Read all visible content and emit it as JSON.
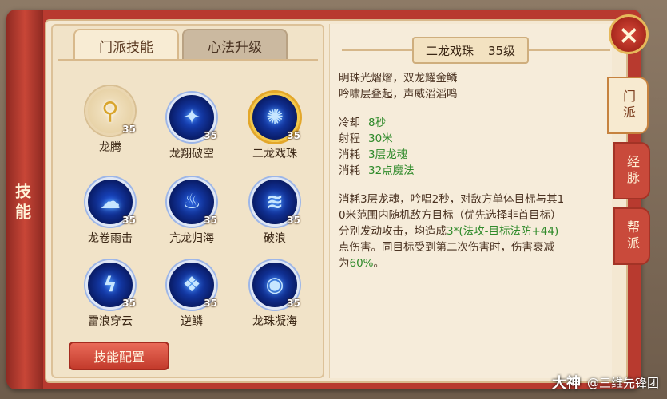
{
  "side_rail": {
    "label": "技能"
  },
  "tabs": [
    {
      "label": "门派技能",
      "active": true
    },
    {
      "label": "心法升级",
      "active": false
    }
  ],
  "skills": [
    {
      "name": "龙腾",
      "level": "35",
      "icon": "golden-mace-icon",
      "selected": false
    },
    {
      "name": "龙翔破空",
      "level": "35",
      "icon": "blue-dragon-icon",
      "selected": false
    },
    {
      "name": "二龙戏珠",
      "level": "35",
      "icon": "dragon-pearl-icon",
      "selected": true
    },
    {
      "name": "龙卷雨击",
      "level": "35",
      "icon": "storm-icon",
      "selected": false
    },
    {
      "name": "亢龙归海",
      "level": "35",
      "icon": "blue-flame-icon",
      "selected": false
    },
    {
      "name": "破浪",
      "level": "35",
      "icon": "wave-icon",
      "selected": false
    },
    {
      "name": "雷浪穿云",
      "level": "35",
      "icon": "lightning-icon",
      "selected": false
    },
    {
      "name": "逆鳞",
      "level": "35",
      "icon": "scales-icon",
      "selected": false
    },
    {
      "name": "龙珠凝海",
      "level": "35",
      "icon": "orb-icon",
      "selected": false
    }
  ],
  "config_button": "技能配置",
  "detail": {
    "name": "二龙戏珠",
    "level": "35级",
    "flavor_line1": "明珠光熠熠，双龙耀金鳞",
    "flavor_line2": "吟啸层叠起，声威滔滔鸣",
    "stats": [
      {
        "label": "冷却",
        "value": "8秒"
      },
      {
        "label": "射程",
        "value": "30米"
      },
      {
        "label": "消耗",
        "value": "3层龙魂"
      },
      {
        "label": "消耗",
        "value": "32点魔法"
      }
    ],
    "desc_line1": "消耗3层龙魂，吟唱2秒，对敌方单体目标与其1",
    "desc_line2": "0米范围内随机敌方目标（优先选择非首目标）",
    "desc_line3a": "分别发动攻击，均造成",
    "desc_line3b": "3*(法攻-目标法防+44)",
    "desc_line4a": "点伤害。同目标受到第二次伤害时，伤害衰减",
    "desc_line5a": "为",
    "desc_line5b": "60%",
    "desc_line5c": "。"
  },
  "side_tabs": [
    {
      "label": "门派",
      "active": true
    },
    {
      "label": "经脉",
      "active": false
    },
    {
      "label": "帮派",
      "active": false
    }
  ],
  "close_icon": "×",
  "watermark": {
    "logo": "大神",
    "text": "@三维先锋团"
  },
  "colors": {
    "accent_red": "#c33b2c",
    "stat_green": "#2f8a2a",
    "selected_gold": "#f3c84a"
  }
}
